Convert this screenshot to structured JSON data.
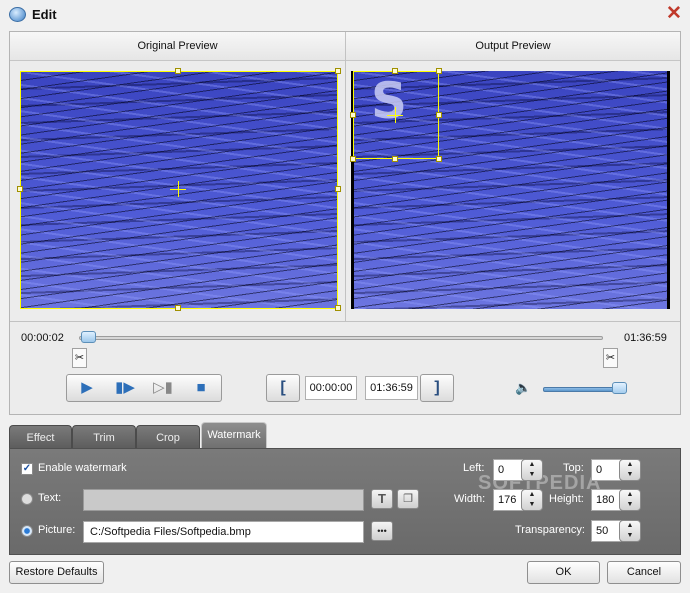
{
  "window": {
    "title": "Edit",
    "close_label": "✕"
  },
  "preview": {
    "original_label": "Original Preview",
    "output_label": "Output Preview",
    "watermark_preview_text": "S"
  },
  "timeline": {
    "current_time": "00:00:02",
    "end_time": "01:36:59",
    "scrub_position": 0.0
  },
  "playback": {
    "start_bracket": "[",
    "end_bracket": "]",
    "trim_start": "00:00:00",
    "trim_end": "01:36:59",
    "volume_level": 0.88
  },
  "tabs": [
    {
      "label": "Effect",
      "active": false
    },
    {
      "label": "Trim",
      "active": false
    },
    {
      "label": "Crop",
      "active": false
    },
    {
      "label": "Watermark",
      "active": true
    }
  ],
  "watermark": {
    "enable_label": "Enable watermark",
    "enabled": true,
    "text_label": "Text:",
    "text_value": "",
    "picture_label": "Picture:",
    "picture_value": "C:/Softpedia Files/Softpedia.bmp",
    "browse_label": "•••",
    "left_label": "Left:",
    "left_value": "0",
    "top_label": "Top:",
    "top_value": "0",
    "width_label": "Width:",
    "width_value": "176",
    "height_label": "Height:",
    "height_value": "180",
    "transparency_label": "Transparency:",
    "transparency_value": "50",
    "brand_text": "SOFTPEDIA"
  },
  "footer": {
    "restore_label": "Restore Defaults",
    "ok_label": "OK",
    "cancel_label": "Cancel"
  },
  "colors": {
    "selection": "#ffff00",
    "accent": "#2d6fb9",
    "tab_bg": "#6a6a6a"
  }
}
